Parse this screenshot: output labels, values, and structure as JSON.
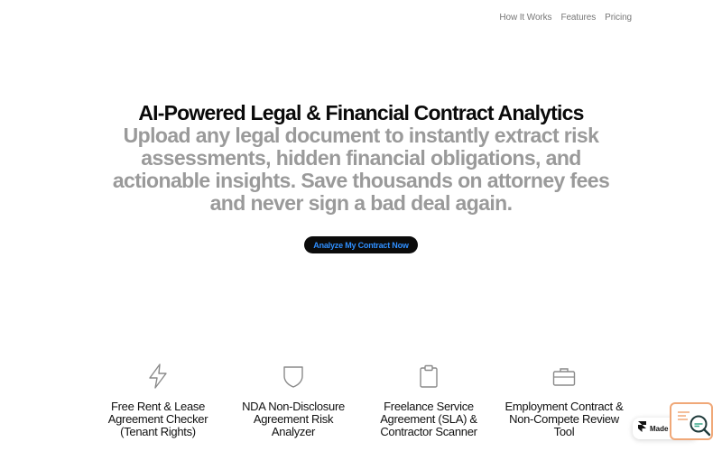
{
  "nav": {
    "items": [
      "How It Works",
      "Features",
      "Pricing"
    ]
  },
  "hero": {
    "title": "AI-Powered Legal & Financial Contract Analytics",
    "subtitle": "Upload any legal document to instantly extract risk assessments, hidden financial obligations, and actionable insights. Save thousands on attorney fees and never sign a bad deal again."
  },
  "cta": {
    "label": "Analyze My Contract Now"
  },
  "features": [
    {
      "icon": "lightning-icon",
      "title": "Free Rent & Lease Agreement Checker (Tenant Rights)"
    },
    {
      "icon": "shield-icon",
      "title": "NDA Non-Disclosure Agreement Risk Analyzer"
    },
    {
      "icon": "clipboard-icon",
      "title": "Freelance Service Agreement (SLA) & Contractor Scanner"
    },
    {
      "icon": "briefcase-icon",
      "title": "Employment Contract & Non-Compete Review Tool"
    }
  ],
  "badge": {
    "label": "Made in Fr"
  },
  "colors": {
    "title": "#0a0a0a",
    "subtitle": "#9a9a9a",
    "cta_bg": "#0b0b0b",
    "cta_text": "#2f8fff",
    "widget_accent": "#f0a878"
  }
}
